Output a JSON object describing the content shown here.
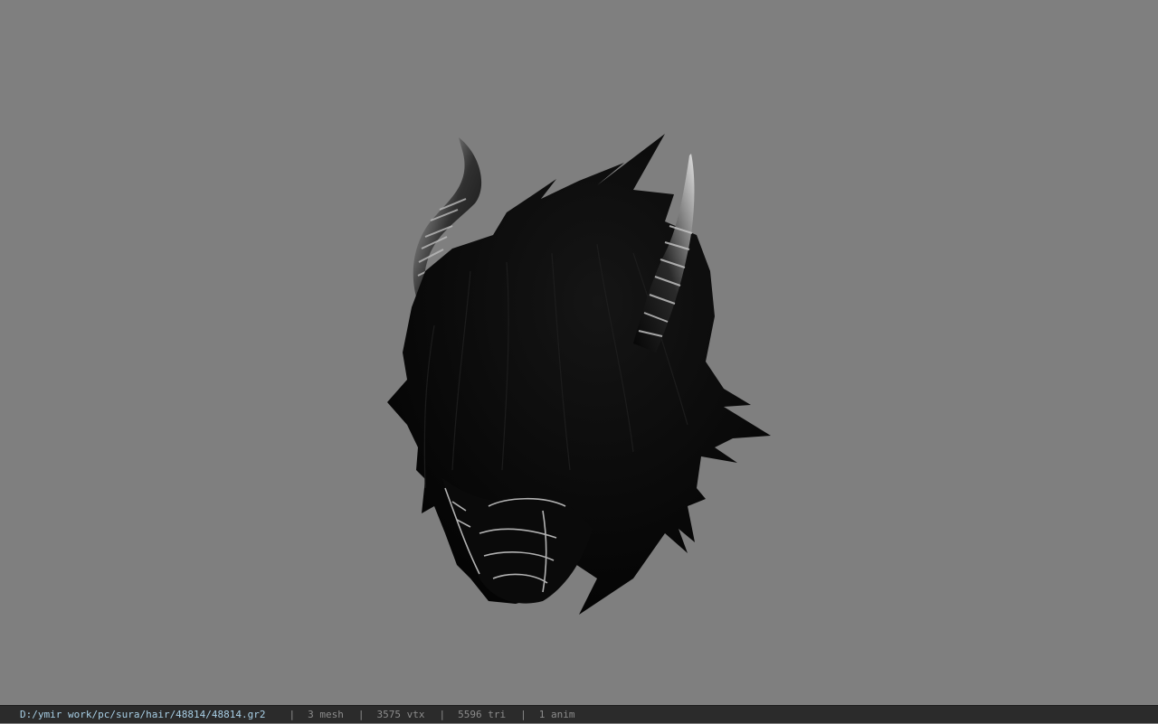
{
  "viewport": {
    "background": "#7f7f7f",
    "model_description_icon": "horned-hair-mesh-icon"
  },
  "statusbar": {
    "path": "D:/ymir work/pc/sura/hair/48814/48814.gr2",
    "separator": "|",
    "mesh": "3 mesh",
    "vtx": "3575 vtx",
    "tri": "5596 tri",
    "anim": "1 anim",
    "path_color": "#a8cfe6",
    "text_color": "#8c8c8c"
  }
}
